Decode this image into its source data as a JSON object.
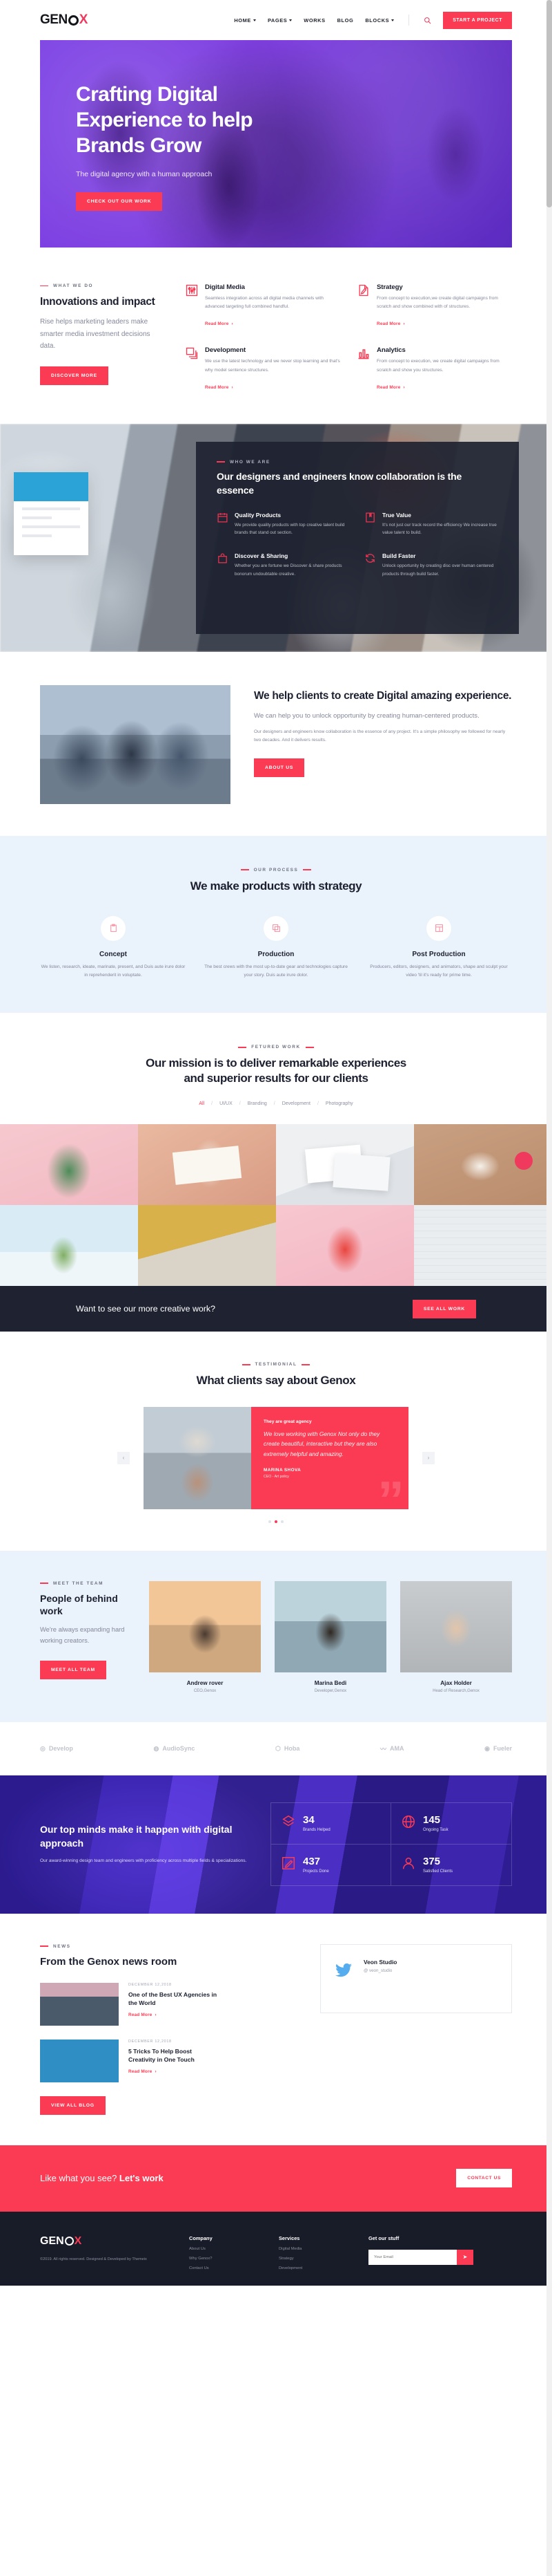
{
  "colors": {
    "accent": "#fb3a53",
    "dark": "#1f2331",
    "purple": "#7b3fe4",
    "lightblue": "#eaf2fb"
  },
  "header": {
    "logo": {
      "part1": "GEN",
      "ring": "O",
      "part2": "X"
    },
    "nav": [
      {
        "label": "HOME",
        "caret": true
      },
      {
        "label": "PAGES",
        "caret": true
      },
      {
        "label": "WORKS",
        "caret": false
      },
      {
        "label": "BLOG",
        "caret": false
      },
      {
        "label": "BLOCKS",
        "caret": true
      }
    ],
    "search_icon": "search-icon",
    "cta": "START A PROJECT"
  },
  "hero": {
    "title": "Crafting Digital Experience to help Brands Grow",
    "subtitle": "The digital agency with a human approach",
    "cta": "CHECK OUT OUR WORK"
  },
  "whatwedo": {
    "eyebrow": "WHAT WE DO",
    "title": "Innovations and impact",
    "text": "Rise helps marketing leaders make smarter media investment decisions data.",
    "cta": "DISCOVER MORE",
    "services": [
      {
        "icon": "sliders-icon",
        "title": "Digital Media",
        "text": "Seamless integration across all digital media channels with advanced targeting full combined handful.",
        "link": "Read More"
      },
      {
        "icon": "pencil-document-icon",
        "title": "Strategy",
        "text": "From concept to execution,we create digital campaigns from scratch and show combined with of structures.",
        "link": "Read More"
      },
      {
        "icon": "layers-icon",
        "title": "Development",
        "text": "We use the latest technology and we never stop learning and that's why model sentence structures.",
        "link": "Read More"
      },
      {
        "icon": "bar-chart-icon",
        "title": "Analytics",
        "text": "From concept to execution, we create digital campaigns from scratch and show you structures.",
        "link": "Read More"
      }
    ]
  },
  "collab": {
    "eyebrow": "WHO WE ARE",
    "title": "Our designers and engineers know collaboration is the essence",
    "features": [
      {
        "icon": "calendar-icon",
        "title": "Quality Products",
        "text": "We provide quality products with top creative talent build brands that stand out section."
      },
      {
        "icon": "bookmark-icon",
        "title": "True Value",
        "text": "It's not just our track record the efficiency We increase true value talent to build."
      },
      {
        "icon": "bag-icon",
        "title": "Discover & Sharing",
        "text": "Whether you are fortune we Discover & share products bonorum undoubtable creative."
      },
      {
        "icon": "refresh-icon",
        "title": "Build Faster",
        "text": "Unlock opportunity by creating disc over human centered products through build faster."
      }
    ]
  },
  "help": {
    "title": "We help clients to create Digital amazing experience.",
    "lead": "We can help you to unlock opportunity by creating human-centered products.",
    "body": "Our designers and engineers know collaboration is the essence of any project. It's a simple philosophy we followed for nearly two decades. And it delivers results.",
    "cta": "ABOUT US"
  },
  "process": {
    "eyebrow": "OUR PROCESS",
    "title": "We make products with strategy",
    "steps": [
      {
        "icon": "clipboard-icon",
        "title": "Concept",
        "text": "We listen, research, ideate, marinate, present, and Duis aute irure dolor in reprehenderit in voluptate."
      },
      {
        "icon": "copy-icon",
        "title": "Production",
        "text": "The best crews with the most up-to-date gear and technologies capture your story. Duis aute irure dolor."
      },
      {
        "icon": "layout-icon",
        "title": "Post Production",
        "text": "Producers, editors, designers, and animators, shape and sculpt your video 'til it's ready for prime time."
      }
    ]
  },
  "portfolio": {
    "eyebrow": "FETURED WORK",
    "title": "Our mission is to deliver remarkable experiences and superior results for our clients",
    "filters": [
      "All",
      "UI/UX",
      "Branding",
      "Development",
      "Photography"
    ],
    "active_filter": "All"
  },
  "darkcta": {
    "text": "Want to see our more creative work?",
    "cta": "SEE ALL WORK"
  },
  "testimonial": {
    "eyebrow": "TESTIMONIAL",
    "title": "What clients say about Genox",
    "heading": "They are great agency",
    "quote": "We love working with Genox Not only do they create beautiful, interactive but they are also extremely helpful and amazing.",
    "author": "MARINA SHOVA",
    "role": "CEO - Art policy",
    "prev_icon": "chevron-left-icon",
    "next_icon": "chevron-right-icon",
    "dots": 3,
    "active_dot": 1
  },
  "team": {
    "eyebrow": "MEET THE TEAM",
    "title": "People of behind work",
    "text": "We're always expanding hard working creators.",
    "cta": "MEET ALL TEAM",
    "members": [
      {
        "name": "Andrew rover",
        "role": "CEO,Genox"
      },
      {
        "name": "Marina Bedi",
        "role": "Developer,Genox"
      },
      {
        "name": "Ajax Holder",
        "role": "Head of Research,Genox"
      }
    ]
  },
  "clients": [
    {
      "icon": "dev-icon",
      "label": "Develop"
    },
    {
      "icon": "circle-icon",
      "label": "AudioSync"
    },
    {
      "icon": "hexa-icon",
      "label": "Hoba"
    },
    {
      "icon": "wave-icon",
      "label": "AMA"
    },
    {
      "icon": "globe-icon",
      "label": "Fueler"
    }
  ],
  "counters": {
    "title": "Our top minds make it happen with digital approach",
    "text": "Our award-winning design team and engineers with proficiency across multiple fields & specializations.",
    "items": [
      {
        "icon": "stack-icon",
        "value": "34",
        "label": "Brands Helped"
      },
      {
        "icon": "globe-grid-icon",
        "value": "145",
        "label": "Ongoing Task"
      },
      {
        "icon": "pencil-box-icon",
        "value": "437",
        "label": "Projects Done"
      },
      {
        "icon": "user-icon",
        "value": "375",
        "label": "Satisfied Clients"
      }
    ]
  },
  "news": {
    "eyebrow": "NEWS",
    "title": "From the Genox news room",
    "posts": [
      {
        "date": "DECEMBER 12,2018",
        "title": "One of the Best UX Agencies in the World",
        "link": "Read More"
      },
      {
        "date": "DECEMBER 12,2018",
        "title": "5 Tricks To Help Boost Creativity in One Touch",
        "link": "Read More"
      }
    ],
    "cta": "VIEW ALL BLOG",
    "twitter": {
      "icon": "twitter-icon",
      "name": "Veon Studio",
      "handle": "@ veon_studio"
    }
  },
  "pinkcta": {
    "pre": "Like what you see? ",
    "bold": "Let's work",
    "cta": "CONTACT US"
  },
  "footer": {
    "logo": {
      "part1": "GEN",
      "ring": "O",
      "part2": "X"
    },
    "about": "©2019. All rights reserved. Designed & Developed by Themeix",
    "columns": [
      {
        "title": "Company",
        "links": [
          "About Us",
          "Why Genox?",
          "Contact Us"
        ]
      },
      {
        "title": "Services",
        "links": [
          "Digital Media",
          "Strategy",
          "Development"
        ]
      }
    ],
    "newsletter": {
      "title": "Get our stuff",
      "placeholder": "Your Email",
      "button_icon": "send-icon"
    }
  }
}
